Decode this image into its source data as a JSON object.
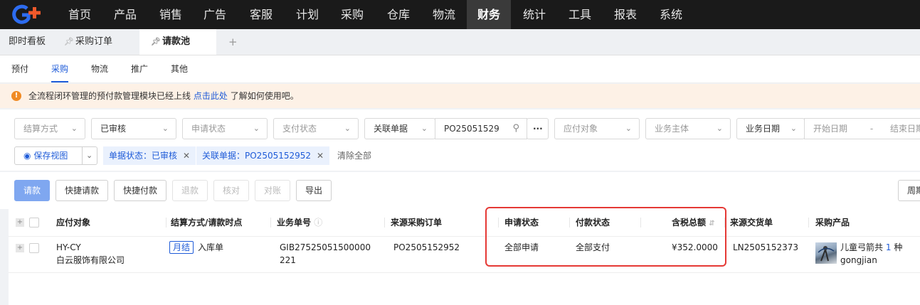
{
  "nav": {
    "logo_text": "G+",
    "items": [
      "首页",
      "产品",
      "销售",
      "广告",
      "客服",
      "计划",
      "采购",
      "仓库",
      "物流",
      "财务",
      "统计",
      "工具",
      "报表",
      "系统"
    ],
    "active": "财务"
  },
  "tabs": [
    {
      "label": "即时看板"
    },
    {
      "label": "采购订单"
    },
    {
      "label": "请款池"
    }
  ],
  "tab_add": "+",
  "subtabs": [
    "预付",
    "采购",
    "物流",
    "推广",
    "其他"
  ],
  "notice": {
    "icon": "!",
    "text_before": "全流程闭环管理的预付款管理模块已经上线",
    "link": "点击此处",
    "text_after": "了解如何使用吧。"
  },
  "filters": {
    "settlement": "结算方式",
    "audit": "已审核",
    "apply_status": "申请状态",
    "pay_status": "支付状态",
    "related_doc_type": "关联单据",
    "related_doc_value": "PO25051529",
    "more": "···",
    "payee": "应付对象",
    "entity": "业务主体",
    "date_type": "业务日期",
    "start_date": "开始日期",
    "date_sep": "-",
    "end_date": "结束日期",
    "save_view": "保存视图",
    "tag_status": "单据状态：已审核",
    "tag_related": "关联单据：PO2505152952",
    "clear_all": "清除全部"
  },
  "toolbar": {
    "request": "请款",
    "quick_request": "快捷请款",
    "quick_pay": "快捷付款",
    "refund": "退款",
    "verify": "核对",
    "reconcile": "对账",
    "export": "导出",
    "period": "周期"
  },
  "table": {
    "headers": {
      "payee": "应付对象",
      "settle": "结算方式/请款时点",
      "biz_no": "业务单号",
      "src_po": "来源采购订单",
      "apply_status": "申请状态",
      "pay_status": "付款状态",
      "total": "含税总额",
      "src_delivery": "来源交货单",
      "product": "采购产品"
    },
    "rows": [
      {
        "payee_code": "HY-CY",
        "payee_name": "白云服饰有限公司",
        "settle_badge": "月结",
        "settle_point": "入库单",
        "biz_no_1": "GIB27525051500000",
        "biz_no_2": "221",
        "src_po": "PO2505152952",
        "apply_status": "全部申请",
        "pay_status": "全部支付",
        "total": "¥352.0000",
        "src_delivery": "LN2505152373",
        "product_prefix": "儿童弓箭共",
        "product_count": "1",
        "product_unit": "种",
        "product_sku": "gongjian"
      }
    ]
  },
  "colors": {
    "accent": "#1e5bd8",
    "highlight_box": "#e53935",
    "topbar": "#1a1a1a"
  }
}
